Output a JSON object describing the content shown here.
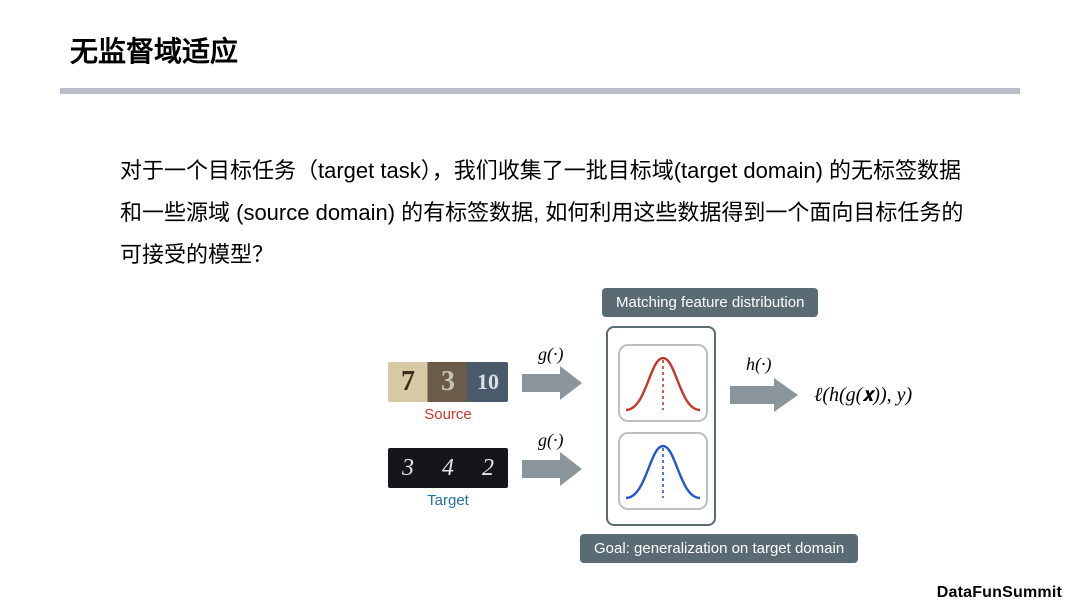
{
  "title": "无监督域适应",
  "body": "对于一个目标任务（target task），我们收集了一批目标域(target domain) 的无标签数据和一些源域 (source domain) 的有标签数据, 如何利用这些数据得到一个面向目标任务的可接受的模型？",
  "diagram": {
    "badge_top": "Matching feature distribution",
    "badge_bottom": "Goal: generalization on target domain",
    "source_label": "Source",
    "target_label": "Target",
    "g_label": "g(·)",
    "h_label": "h(·)",
    "loss_expr": "ℓ(h(g(𝐱)), y)",
    "source_digits": [
      "7",
      "3",
      "10"
    ],
    "target_digits": [
      "3",
      "4",
      "2"
    ]
  },
  "footer": "DataFunSummit"
}
